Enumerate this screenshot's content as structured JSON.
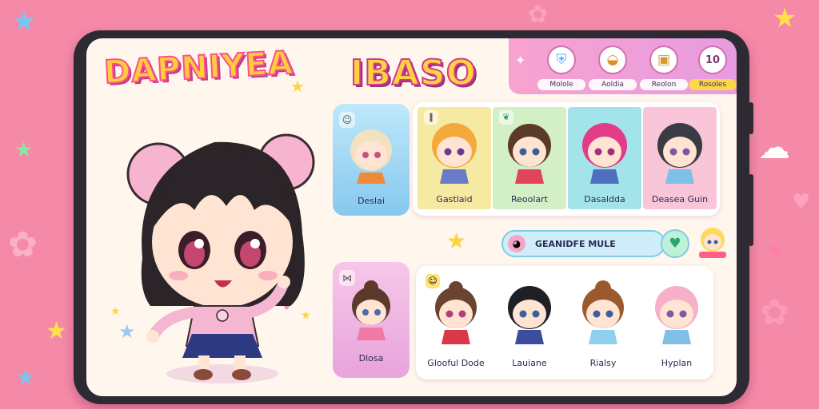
{
  "app": {
    "logo_text": "DAPNIYEA",
    "brand_text": "IBASO"
  },
  "nav": {
    "items": [
      {
        "label": "Molole",
        "icon": "shield-icon",
        "active": false
      },
      {
        "label": "Aoldia",
        "icon": "food-icon",
        "active": false
      },
      {
        "label": "Reolon",
        "icon": "bag-icon",
        "active": false
      },
      {
        "label": "Rosoles",
        "icon": "counter-icon",
        "icon_text": "10",
        "active": true
      }
    ]
  },
  "side_cards": [
    {
      "label": "Deslai",
      "icon": "face-icon"
    },
    {
      "label": "Dlosa",
      "icon": "bow-icon"
    }
  ],
  "top_grid": [
    {
      "label": "Gastlaid",
      "badge": "pause-icon",
      "bg": "#f5e99a"
    },
    {
      "label": "Reoolart",
      "badge": "leaf-icon",
      "bg": "#cdeec3"
    },
    {
      "label": "Dasaldda",
      "badge": "",
      "bg": "#9ee3e9"
    },
    {
      "label": "Deasea Guin",
      "badge": "",
      "bg": "#f7c1d6"
    }
  ],
  "search": {
    "text": "GEANIDFE MULE",
    "icon": "pig-icon",
    "confirm_icon": "heart-icon"
  },
  "bottom_grid": [
    {
      "label": "Glooful Dode",
      "badge": "smile-icon"
    },
    {
      "label": "Lauiane",
      "badge": ""
    },
    {
      "label": "Rialsy",
      "badge": ""
    },
    {
      "label": "Hyplan",
      "badge": ""
    }
  ],
  "colors": {
    "background": "#f58aa8",
    "screen": "#fff6ee",
    "accent_yellow": "#ffd23f",
    "accent_pink": "#d23a8c",
    "nav_active": "#ffd54a"
  }
}
